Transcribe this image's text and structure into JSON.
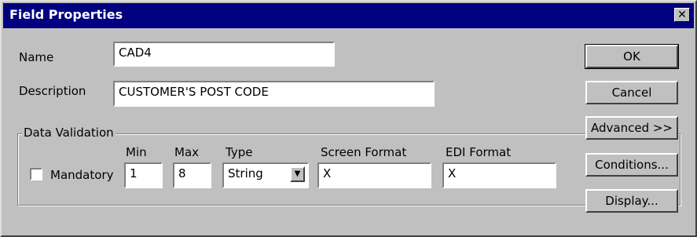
{
  "window": {
    "title": "Field Properties",
    "close_glyph": "✕"
  },
  "fields": {
    "name_label": "Name",
    "name_value": "CAD4",
    "description_label": "Description",
    "description_value": "CUSTOMER'S POST CODE"
  },
  "validation": {
    "group_label": "Data Validation",
    "mandatory_label": "Mandatory",
    "mandatory_checked": false,
    "min_label": "Min",
    "min_value": "1",
    "max_label": "Max",
    "max_value": "8",
    "type_label": "Type",
    "type_value": "String",
    "screen_format_label": "Screen Format",
    "screen_format_value": "X",
    "edi_format_label": "EDI Format",
    "edi_format_value": "X"
  },
  "buttons": {
    "ok": "OK",
    "cancel": "Cancel",
    "advanced": "Advanced >>",
    "conditions": "Conditions...",
    "display": "Display..."
  },
  "colors": {
    "titlebar": "#000080",
    "face": "#c0c0c0"
  }
}
